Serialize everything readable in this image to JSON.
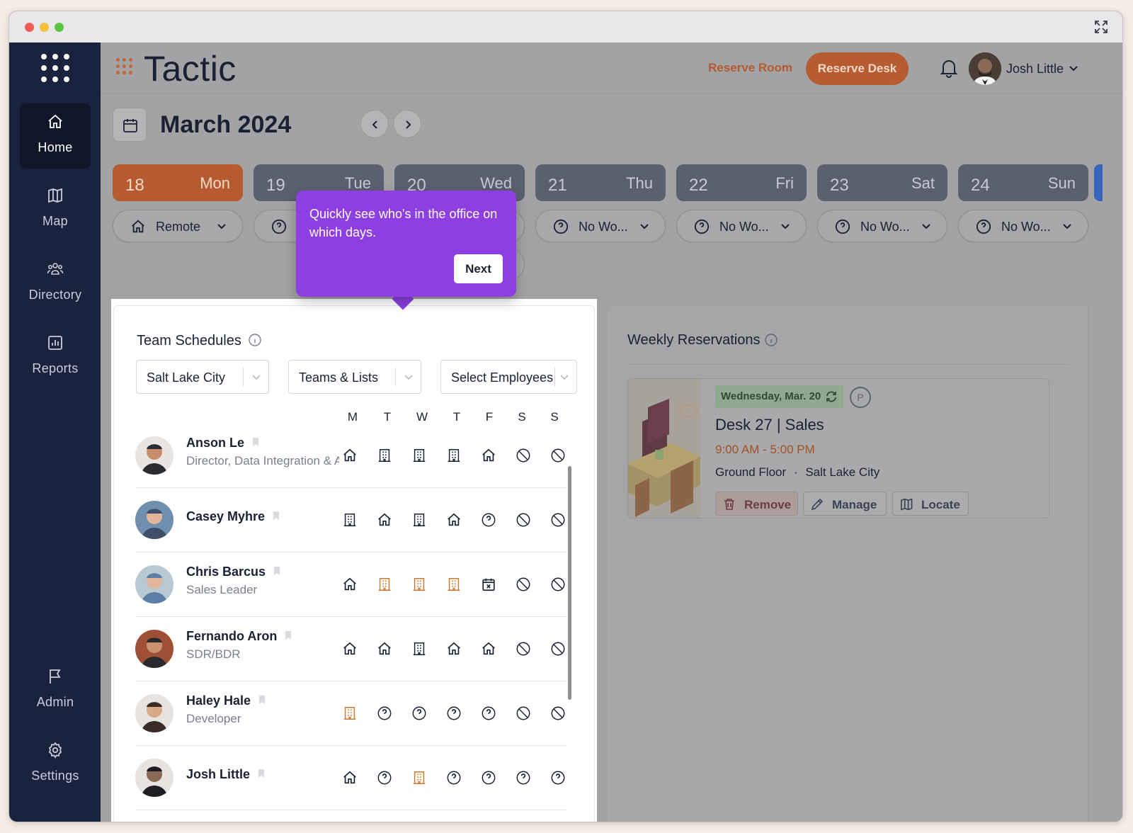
{
  "app": {
    "brand": "Tactic",
    "reserve_room": "Reserve Room",
    "reserve_desk": "Reserve Desk",
    "user_name": "Josh Little",
    "accent": "#b75c30",
    "tooltip_color": "#8d3fe1"
  },
  "sidebar": {
    "items": [
      {
        "label": "Home",
        "icon": "home-icon"
      },
      {
        "label": "Map",
        "icon": "map-icon"
      },
      {
        "label": "Directory",
        "icon": "people-icon"
      },
      {
        "label": "Reports",
        "icon": "chart-icon"
      },
      {
        "label": "Admin",
        "icon": "flag-icon"
      },
      {
        "label": "Settings",
        "icon": "gear-icon"
      }
    ]
  },
  "calendar": {
    "month": "March 2024",
    "days": [
      {
        "num": "18",
        "name": "Mon",
        "status": "Remote"
      },
      {
        "num": "19",
        "name": "Tue",
        "status": ""
      },
      {
        "num": "20",
        "name": "Wed",
        "status": ""
      },
      {
        "num": "21",
        "name": "Thu",
        "status": "No Wo..."
      },
      {
        "num": "22",
        "name": "Fri",
        "status": "No Wo..."
      },
      {
        "num": "23",
        "name": "Sat",
        "status": "No Wo..."
      },
      {
        "num": "24",
        "name": "Sun",
        "status": "No Wo..."
      }
    ]
  },
  "tooltip": {
    "text": "Quickly see who's in the office on which days.",
    "next": "Next"
  },
  "team": {
    "title": "Team Schedules",
    "filters": {
      "location": "Salt Lake City",
      "teams": "Teams & Lists",
      "employees": "Select Employees"
    },
    "weekdays": [
      "M",
      "T",
      "W",
      "T",
      "F",
      "S",
      "S"
    ],
    "rows": [
      {
        "name": "Anson Le",
        "role": "Director, Data Integration & Analytics",
        "days": [
          "home",
          "office",
          "office",
          "office",
          "home",
          "off",
          "off"
        ]
      },
      {
        "name": "Casey Myhre",
        "role": "",
        "days": [
          "office",
          "home",
          "office",
          "home",
          "unknown",
          "off",
          "off"
        ]
      },
      {
        "name": "Chris Barcus",
        "role": "Sales Leader",
        "days": [
          "home",
          "office-booked",
          "office-booked",
          "office-booked",
          "cancelled",
          "off",
          "off"
        ]
      },
      {
        "name": "Fernando Aron",
        "role": "SDR/BDR",
        "days": [
          "home",
          "home",
          "office",
          "home",
          "home",
          "off",
          "off"
        ]
      },
      {
        "name": "Haley Hale",
        "role": "Developer",
        "days": [
          "office-booked",
          "unknown",
          "unknown",
          "unknown",
          "unknown",
          "off",
          "off"
        ]
      },
      {
        "name": "Josh Little",
        "role": "",
        "days": [
          "home",
          "unknown",
          "office-booked",
          "unknown",
          "unknown",
          "unknown",
          "unknown"
        ]
      }
    ]
  },
  "weekly": {
    "title": "Weekly Reservations",
    "reservation": {
      "date": "Wednesday, Mar. 20",
      "parking": "P",
      "title": "Desk 27 | Sales",
      "time": "9:00 AM - 5:00 PM",
      "floor": "Ground Floor",
      "city": "Salt Lake City",
      "remove": "Remove",
      "manage": "Manage",
      "locate": "Locate"
    }
  }
}
